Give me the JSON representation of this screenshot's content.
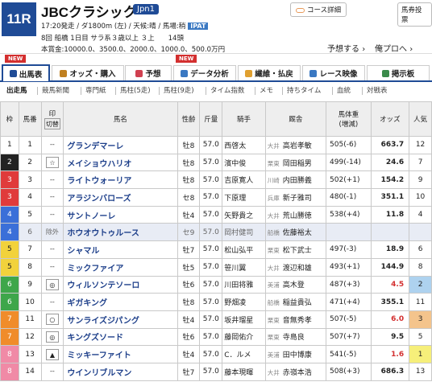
{
  "race": {
    "num": "11R",
    "title": "JBCクラシック",
    "grade": "Jpn1",
    "start": "17:20発走 / ダ1800m (左) / 天候:晴",
    "baba_label": "/ 馬場:稍",
    "ipat": "IPAT",
    "info": "8回 船橋 1日目 サラ系３歳以上 ３上　　14頭",
    "prize": "本賞金:10000.0、3500.0、2000.0、1000.0、500.0万円"
  },
  "header_buttons": {
    "course": "コース詳細",
    "ticket": "馬券投票",
    "pred": "予想する",
    "proj": "俺プロへ"
  },
  "badge": "NEW",
  "tabs": [
    {
      "label": "出馬表",
      "color": "#1f4b96"
    },
    {
      "label": "オッズ・購入",
      "color": "#c08020"
    },
    {
      "label": "予想",
      "color": "#d04050"
    },
    {
      "label": "データ分析",
      "color": "#3a78c2"
    },
    {
      "label": "繊維・払戻",
      "color": "#e0a030"
    },
    {
      "label": "レース映像",
      "color": "#3a78c2"
    },
    {
      "label": "掲示板",
      "color": "#3a8a4a"
    }
  ],
  "subnav": [
    "出走馬",
    "競馬新聞",
    "専門紙",
    "馬柱(5走)",
    "馬柱(9走)",
    "タイム指数",
    "メモ",
    "持ちタイム",
    "血統",
    "対戦表"
  ],
  "cols": [
    "枠",
    "馬番",
    "印",
    "切替",
    "馬名",
    "性齢",
    "斤量",
    "騎手",
    "厩舎",
    "馬体重",
    "(増減)",
    "オッズ",
    "人気"
  ],
  "rows": [
    {
      "waku": "1",
      "ban": "1",
      "mk": "--",
      "name": "グランデマーレ",
      "sa": "牡8",
      "kin": "57.0",
      "jockey": "西啓太",
      "loc": "大井",
      "trainer": "高岩孝敏",
      "wt": "505(-6)",
      "odds": "663.7",
      "pop": "12"
    },
    {
      "waku": "2",
      "ban": "2",
      "mk": "☆",
      "name": "メイショウハリオ",
      "sa": "牡8",
      "kin": "57.0",
      "jockey": "濱中俊",
      "loc": "栗東",
      "trainer": "岡田稲男",
      "wt": "499(-14)",
      "odds": "24.6",
      "pop": "7"
    },
    {
      "waku": "3",
      "ban": "3",
      "mk": "--",
      "name": "ライトウォーリア",
      "sa": "牡8",
      "kin": "57.0",
      "jockey": "吉原寛人",
      "loc": "川崎",
      "trainer": "内田勝義",
      "wt": "502(+1)",
      "odds": "154.2",
      "pop": "9"
    },
    {
      "waku": "3",
      "ban": "4",
      "mk": "--",
      "name": "アラジンバローズ",
      "sa": "セ8",
      "kin": "57.0",
      "jockey": "下原理",
      "loc": "兵庫",
      "trainer": "新子雅司",
      "wt": "480(-1)",
      "odds": "351.1",
      "pop": "10"
    },
    {
      "waku": "4",
      "ban": "5",
      "mk": "--",
      "name": "サントノーレ",
      "sa": "牡4",
      "kin": "57.0",
      "jockey": "矢野貴之",
      "loc": "大井",
      "trainer": "荒山勝徳",
      "wt": "538(+4)",
      "odds": "11.8",
      "pop": "4"
    },
    {
      "waku": "4",
      "ban": "6",
      "mk": "除外",
      "name": "ホウオウトゥルース",
      "sa": "セ9",
      "kin": "57.0",
      "jockey": "岡村健司",
      "loc": "船橋",
      "trainer": "佐藤裕太",
      "wt": "",
      "odds": "",
      "pop": ""
    },
    {
      "waku": "5",
      "ban": "7",
      "mk": "--",
      "name": "シャマル",
      "sa": "牡7",
      "kin": "57.0",
      "jockey": "松山弘平",
      "loc": "栗東",
      "trainer": "松下武士",
      "wt": "497(-3)",
      "odds": "18.9",
      "pop": "6"
    },
    {
      "waku": "5",
      "ban": "8",
      "mk": "--",
      "name": "ミックファイア",
      "sa": "牡5",
      "kin": "57.0",
      "jockey": "笹川翼",
      "loc": "大井",
      "trainer": "渡辺和雄",
      "wt": "493(+1)",
      "odds": "144.9",
      "pop": "8"
    },
    {
      "waku": "6",
      "ban": "9",
      "mk": "◎",
      "name": "ウィルソンテソーロ",
      "sa": "牡6",
      "kin": "57.0",
      "jockey": "川田将雅",
      "loc": "美浦",
      "trainer": "高木登",
      "wt": "487(+3)",
      "odds": "4.5",
      "pop": "2"
    },
    {
      "waku": "6",
      "ban": "10",
      "mk": "--",
      "name": "ギガキング",
      "sa": "牡8",
      "kin": "57.0",
      "jockey": "野畑凌",
      "loc": "船橋",
      "trainer": "稲益貴弘",
      "wt": "471(+4)",
      "odds": "355.1",
      "pop": "11"
    },
    {
      "waku": "7",
      "ban": "11",
      "mk": "○",
      "name": "サンライズジパング",
      "sa": "牡4",
      "kin": "57.0",
      "jockey": "坂井瑠星",
      "loc": "栗東",
      "trainer": "音無秀孝",
      "wt": "507(-5)",
      "odds": "6.0",
      "pop": "3"
    },
    {
      "waku": "7",
      "ban": "12",
      "mk": "◎",
      "name": "キングズソード",
      "sa": "牡6",
      "kin": "57.0",
      "jockey": "藤岡佑介",
      "loc": "栗東",
      "trainer": "寺島良",
      "wt": "507(+7)",
      "odds": "9.5",
      "pop": "5"
    },
    {
      "waku": "8",
      "ban": "13",
      "mk": "▲",
      "name": "ミッキーファイト",
      "sa": "牡4",
      "kin": "57.0",
      "jockey": "C．ルメ",
      "loc": "美浦",
      "trainer": "田中博康",
      "wt": "541(-5)",
      "odds": "1.6",
      "pop": "1"
    },
    {
      "waku": "8",
      "ban": "14",
      "mk": "--",
      "name": "ウインリブルマン",
      "sa": "牡7",
      "kin": "57.0",
      "jockey": "藤本現暉",
      "loc": "大井",
      "trainer": "赤嶺本浩",
      "wt": "508(+3)",
      "odds": "686.3",
      "pop": "13"
    }
  ],
  "waku_colors": {
    "1": "#ffffff",
    "2": "#222222",
    "3": "#e03b3b",
    "4": "#3a6fd8",
    "5": "#f2d23c",
    "6": "#3ea64a",
    "7": "#f08c2a",
    "8": "#f08aa6"
  },
  "hot_odds_color": "#d32f2f"
}
